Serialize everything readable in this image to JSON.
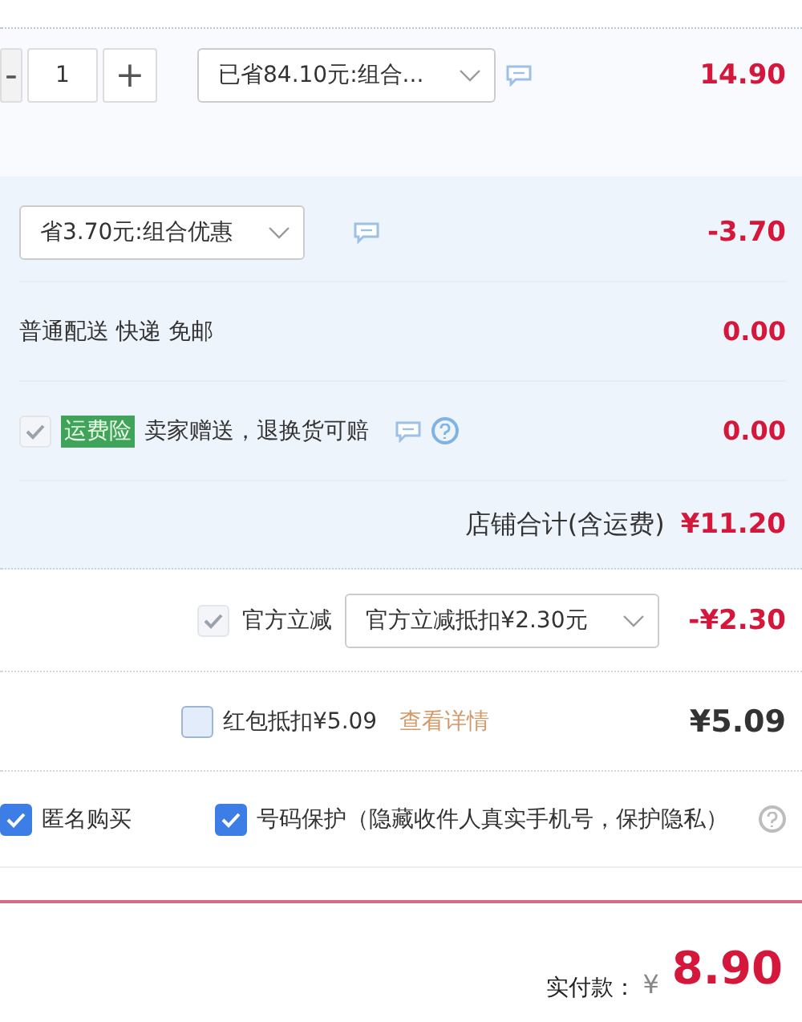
{
  "item": {
    "minus": "-",
    "quantity": "1",
    "plus": "+",
    "promo_select": "已省84.10元:组合...",
    "price": "14.90"
  },
  "shop": {
    "promo_select": "省3.70元:组合优惠",
    "promo_amount": "-3.70",
    "shipping": {
      "label": "普通配送 快递 免邮",
      "amount": "0.00"
    },
    "insurance": {
      "checked": true,
      "disabled": true,
      "tag": "运费险",
      "text": "卖家赠送，退换货可赔",
      "amount": "0.00"
    },
    "total": {
      "label": "店铺合计(含运费)",
      "amount": "¥11.20"
    }
  },
  "official_discount": {
    "checked": true,
    "disabled": true,
    "label": "官方立减",
    "select": "官方立减抵扣¥2.30元",
    "amount": "-¥2.30"
  },
  "red_packet": {
    "checked": false,
    "disabled": false,
    "label": "红包抵扣¥5.09",
    "link": "查看详情",
    "amount": "¥5.09"
  },
  "options": [
    {
      "label": "匿名购买",
      "checked": true,
      "disabled": false
    },
    {
      "label": "号码保护（隐藏收件人真实手机号，保护隐私）",
      "checked": true,
      "disabled": false
    }
  ],
  "payment": {
    "label": "实付款：",
    "currency": "¥",
    "amount": "8.90"
  }
}
